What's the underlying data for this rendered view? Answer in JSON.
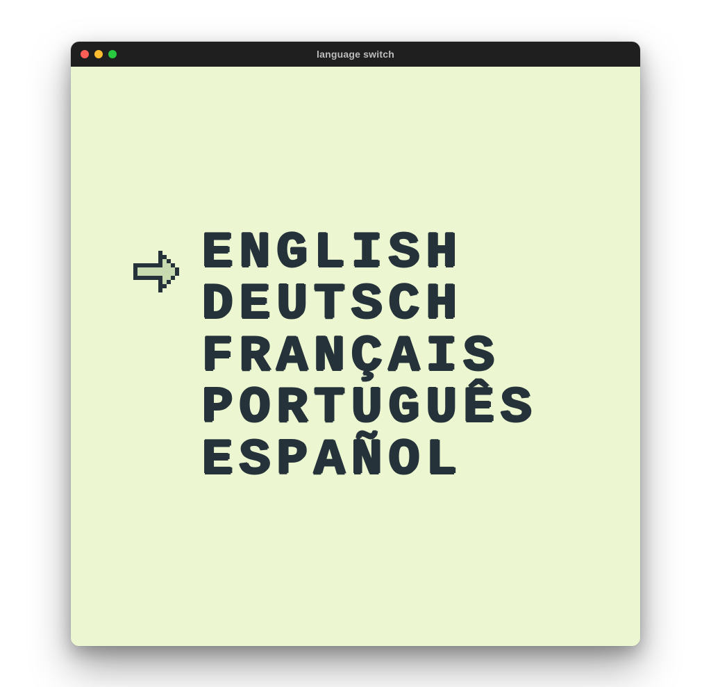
{
  "window": {
    "title": "language switch"
  },
  "menu": {
    "selected_index": 0,
    "items": [
      {
        "label": "English"
      },
      {
        "label": "Deutsch"
      },
      {
        "label": "Français"
      },
      {
        "label": "Português"
      },
      {
        "label": "Español"
      }
    ]
  },
  "colors": {
    "screen_bg": "#ecf7d1",
    "ink": "#26323a",
    "arrow_fill": "#c8dab0"
  }
}
